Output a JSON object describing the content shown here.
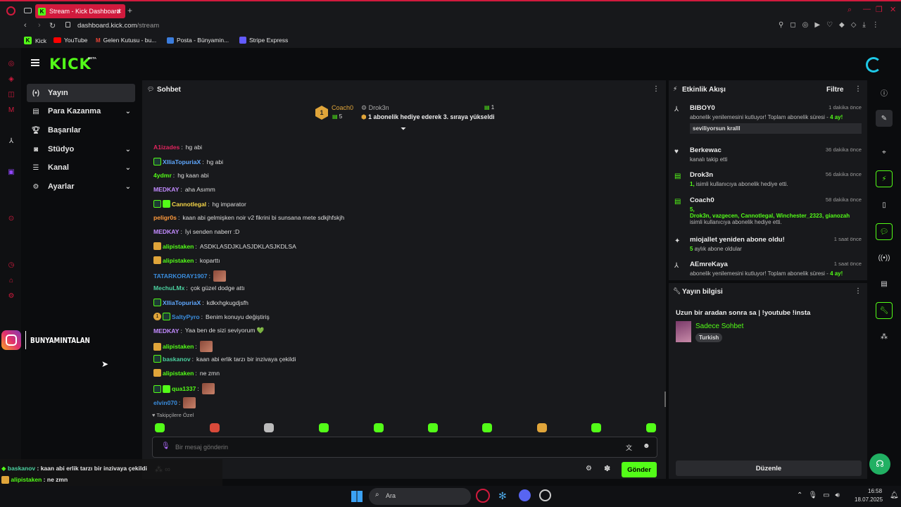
{
  "browser": {
    "tab_title": "Stream - Kick Dashboard",
    "url_host": "dashboard.kick.com",
    "url_path": "/stream",
    "bookmarks": [
      "Kick",
      "YouTube",
      "Gelen Kutusu - bu...",
      "Posta - Bünyamin...",
      "Stripe Express"
    ]
  },
  "logo": "KICK",
  "logo_beta": "BETA",
  "nav": {
    "items": [
      {
        "label": "Yayın",
        "icon": "broadcast-icon",
        "active": true
      },
      {
        "label": "Para Kazanma",
        "icon": "money-icon",
        "expandable": true
      },
      {
        "label": "Başarılar",
        "icon": "trophy-icon"
      },
      {
        "label": "Stüdyo",
        "icon": "studio-icon",
        "expandable": true
      },
      {
        "label": "Kanal",
        "icon": "channel-icon",
        "expandable": true
      },
      {
        "label": "Ayarlar",
        "icon": "gear-icon",
        "expandable": true
      }
    ]
  },
  "overlay": {
    "instagram_handle": "BUNYAMINTALAN"
  },
  "chat": {
    "title": "Sohbet",
    "pinned": {
      "rank": "1",
      "gifter": "Coach0",
      "gifter_count": "5",
      "user": "Drok3n",
      "user_count": "1",
      "text": "1 abonelik hediye ederek 3. sıraya yükseldi"
    },
    "messages": [
      {
        "user": "A1izades",
        "color": "#e0245e",
        "text": "hg abi",
        "badges": []
      },
      {
        "user": "XlliaTopuriaX",
        "color": "#5fa8ff",
        "text": "hg abi",
        "badges": [
          "sub"
        ]
      },
      {
        "user": "4ydmr",
        "color": "#53fc18",
        "text": "hg kaan abi",
        "badges": []
      },
      {
        "user": "MEDKAY",
        "color": "#c28bff",
        "text": "aha Asımm",
        "badges": []
      },
      {
        "user": "Cannotlegal",
        "color": "#f5d547",
        "text": "hg imparator",
        "badges": [
          "sub",
          "gift"
        ]
      },
      {
        "user": "peligr0s",
        "color": "#ff9a3c",
        "text": "kaan abi gelmişken noir v2 fikrini bi sunsana mete sdkjhfskjh",
        "badges": []
      },
      {
        "user": "MEDKAY",
        "color": "#c28bff",
        "text": "İyi senden naberr :D",
        "badges": []
      },
      {
        "user": "alipistaken",
        "color": "#53fc18",
        "text": "ASDKLASDJKLASJDKLASJKDLSA",
        "badges": [
          "crown"
        ]
      },
      {
        "user": "alipistaken",
        "color": "#53fc18",
        "text": "koparttı",
        "badges": [
          "crown"
        ]
      },
      {
        "user": "TATARKORAY1907",
        "color": "#3a8dde",
        "text": "",
        "badges": [],
        "emote": true
      },
      {
        "user": "MechuLMx",
        "color": "#4bd1a0",
        "text": "çok güzel dodge attı",
        "badges": []
      },
      {
        "user": "XlliaTopuriaX",
        "color": "#5fa8ff",
        "text": "kdkxhgkugdjsfh",
        "badges": [
          "sub"
        ]
      },
      {
        "user": "SaltyPyro",
        "color": "#3a8dde",
        "text": "Benim konuyu değiştiriş",
        "badges": [
          "one",
          "sub"
        ]
      },
      {
        "user": "MEDKAY",
        "color": "#c28bff",
        "text": "Yaa ben de sizi seviyorum 💚",
        "badges": []
      },
      {
        "user": "alipistaken",
        "color": "#53fc18",
        "text": "",
        "badges": [
          "crown"
        ],
        "emote": true
      },
      {
        "user": "baskanov",
        "color": "#4bd1a0",
        "text": "kaan abi erlik tarzı bir inzivaya çekildi",
        "badges": [
          "sub"
        ]
      },
      {
        "user": "alipistaken",
        "color": "#53fc18",
        "text": "ne zmn",
        "badges": [
          "crown"
        ]
      },
      {
        "user": "qua1337",
        "color": "#53fc18",
        "text": "",
        "badges": [
          "sub",
          "gift"
        ],
        "emote": true
      },
      {
        "user": "elvin070",
        "color": "#3a8dde",
        "text": "",
        "badges": [],
        "emote": true
      }
    ],
    "emote_section_label": "Takipçilere Özel",
    "input_placeholder": "Bir mesaj gönderin",
    "send_label": "Gönder",
    "points": "∞"
  },
  "activity": {
    "title": "Etkinlik Akışı",
    "filter_label": "Filtre",
    "events": [
      {
        "user": "BIBOY0",
        "time": "1 dakika önce",
        "line1": "abonelik yenilemesini kutluyor! Toplam abonelik süresi - ",
        "highlight": "4 ay!",
        "message": "seviliyorsun kralll",
        "icon": "resub-icon"
      },
      {
        "user": "Berkewac",
        "time": "36 dakika önce",
        "line1": "kanalı takip etti",
        "icon": "heart-icon"
      },
      {
        "user": "Drok3n",
        "time": "56 dakika önce",
        "highlight": "1,",
        "line1": " isimli kullanıcıya abonelik hediye etti.",
        "icon": "gift-icon"
      },
      {
        "user": "Coach0",
        "time": "58 dakika önce",
        "highlight": "5,",
        "gift_list": "Drok3n, vazgecen, Cannotlegal, Winchester_2323, gianozah",
        "line1": "isimli kullanıcıya abonelik hediye etti.",
        "icon": "gift-icon"
      },
      {
        "user": "miojallet yeniden abone oldu!",
        "time": "1 saat önce",
        "highlight": "5",
        "line1": " aylık abone oldular",
        "icon": "sparkle-icon"
      },
      {
        "user": "AEmreKaya",
        "time": "1 saat önce",
        "line1": "abonelik yenilemesini kutluyor! Toplam abonelik süresi - ",
        "highlight": "4 ay!",
        "icon": "resub-icon"
      }
    ]
  },
  "stream_info": {
    "title": "Yayın bilgisi",
    "stream_title": "Uzun bir aradan sonra sa | !youtube !insta",
    "category": "Sadece Sohbet",
    "language_tag": "Turkish",
    "edit_label": "Düzenle"
  },
  "bottom_overlay": [
    {
      "user": "baskanov",
      "text": "kaan abi erlik tarzı bir inzivaya çekildi"
    },
    {
      "user": "alipistaken",
      "text": "ne zmn"
    },
    {
      "user": "qua1337",
      "text": ""
    }
  ],
  "taskbar": {
    "search": "Ara",
    "time": "16:58",
    "date": "18.07.2025"
  },
  "colors": {
    "accent": "#53fc18",
    "opera_red": "#d11a3d",
    "panel": "#18191c"
  }
}
